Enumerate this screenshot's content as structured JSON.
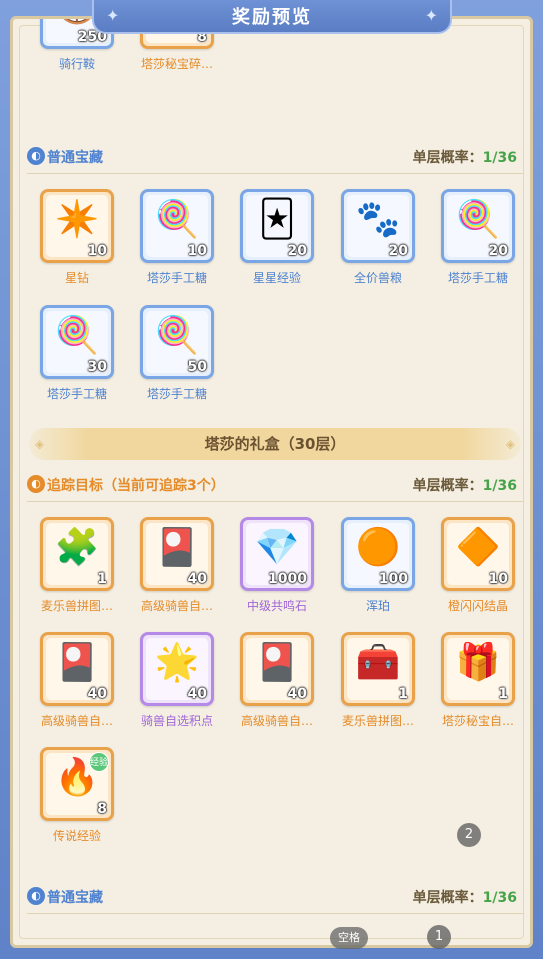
{
  "title": "奖励预览",
  "top_items": [
    {
      "name": "骑行鞍",
      "qty": "250",
      "icon": "saddle-icon",
      "glyph": "🛞",
      "rarity": "blue"
    },
    {
      "name": "塔莎秘宝碎…",
      "qty": "8",
      "icon": "treasure-shard-icon",
      "glyph": "👑",
      "rarity": "orange"
    }
  ],
  "section1": {
    "title": "普通宝藏",
    "prob_label": "单层概率：",
    "prob_value": "1/36",
    "items": [
      {
        "name": "星钻",
        "qty": "10",
        "icon": "star-diamond-icon",
        "glyph": "✴️",
        "rarity": "orange"
      },
      {
        "name": "塔莎手工糖",
        "qty": "10",
        "icon": "lollipop-icon",
        "glyph": "🍭",
        "rarity": "blue"
      },
      {
        "name": "星星经验",
        "qty": "20",
        "icon": "star-card-icon",
        "glyph": "🃏",
        "rarity": "blue"
      },
      {
        "name": "全价兽粮",
        "qty": "20",
        "icon": "food-bag-icon",
        "glyph": "🐾",
        "rarity": "blue"
      },
      {
        "name": "塔莎手工糖",
        "qty": "20",
        "icon": "lollipop-icon",
        "glyph": "🍭",
        "rarity": "blue"
      },
      {
        "name": "塔莎手工糖",
        "qty": "30",
        "icon": "lollipop-icon",
        "glyph": "🍭",
        "rarity": "blue"
      },
      {
        "name": "塔莎手工糖",
        "qty": "50",
        "icon": "lollipop-icon",
        "glyph": "🍭",
        "rarity": "blue"
      }
    ]
  },
  "banner": {
    "text": "塔莎的礼盒（30层）"
  },
  "section2": {
    "title": "追踪目标（当前可追踪3个）",
    "prob_label": "单层概率：",
    "prob_value": "1/36",
    "items": [
      {
        "name": "麦乐兽拼图…",
        "qty": "1",
        "icon": "puzzle-chest-icon",
        "glyph": "🧩",
        "rarity": "orange"
      },
      {
        "name": "高级骑兽自…",
        "qty": "40",
        "icon": "mount-card-icon",
        "glyph": "🎴",
        "rarity": "orange"
      },
      {
        "name": "中级共鸣石",
        "qty": "1000",
        "icon": "resonance-stone-icon",
        "glyph": "💎",
        "rarity": "purple"
      },
      {
        "name": "浑珀",
        "qty": "100",
        "icon": "amber-icon",
        "glyph": "🟠",
        "rarity": "blue"
      },
      {
        "name": "橙闪闪结晶",
        "qty": "10",
        "icon": "orange-crystal-icon",
        "glyph": "🔶",
        "rarity": "orange"
      },
      {
        "name": "高级骑兽自…",
        "qty": "40",
        "icon": "mount-card-icon",
        "glyph": "🎴",
        "rarity": "orange"
      },
      {
        "name": "骑兽自选积点",
        "qty": "40",
        "icon": "mount-points-icon",
        "glyph": "🌟",
        "rarity": "purple"
      },
      {
        "name": "高级骑兽自…",
        "qty": "40",
        "icon": "mount-card-icon",
        "glyph": "🎴",
        "rarity": "orange"
      },
      {
        "name": "麦乐兽拼图…",
        "qty": "1",
        "icon": "puzzle-chest-icon",
        "glyph": "🧰",
        "rarity": "orange"
      },
      {
        "name": "塔莎秘宝自…",
        "qty": "1",
        "icon": "treasure-chest-icon",
        "glyph": "🎁",
        "rarity": "orange"
      },
      {
        "name": "传说经验",
        "qty": "8",
        "icon": "legend-exp-icon",
        "glyph": "🔥",
        "rarity": "orange",
        "badge": "经验"
      }
    ]
  },
  "section3": {
    "title": "普通宝藏",
    "prob_label": "单层概率：",
    "prob_value": "1/36"
  },
  "overlay": {
    "page_badge_2": "2",
    "page_badge_1": "1",
    "space_label": "空格"
  }
}
